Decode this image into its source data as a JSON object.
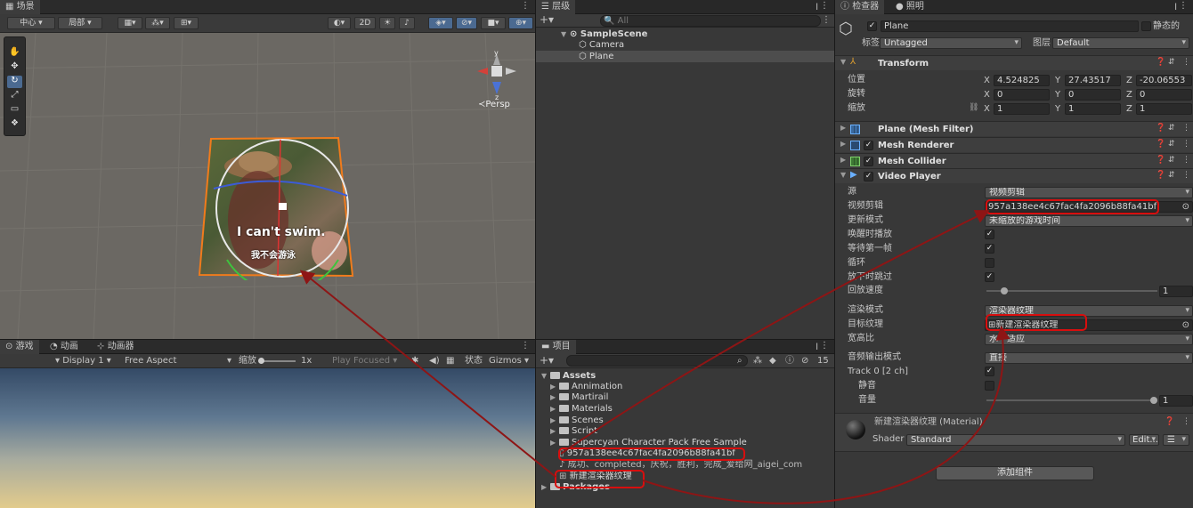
{
  "scene": {
    "tab": "场景",
    "pivot": "中心",
    "space": "局部",
    "mode_2d": "2D",
    "persp": "≺Persp",
    "axis_y": "y",
    "axis_z": "z",
    "subtitle_en": "I can't swim.",
    "subtitle_cn": "我不会游泳"
  },
  "game": {
    "tabs": [
      "游戏",
      "动画",
      "动画器"
    ],
    "display": "Display 1",
    "aspect": "Free Aspect",
    "scale_label": "缩放",
    "scale_value": "1x",
    "play_focused": "Play Focused",
    "stats": "状态",
    "gizmos": "Gizmos"
  },
  "hierarchy": {
    "tab": "层级",
    "search_placeholder": "All",
    "scene": "SampleScene",
    "items": [
      "Camera",
      "Plane"
    ]
  },
  "project": {
    "tab": "项目",
    "count": "15",
    "root": "Assets",
    "folders": [
      "Annimation",
      "Martirail",
      "Materials",
      "Scenes",
      "Script",
      "Supercyan Character Pack Free Sample"
    ],
    "files": [
      "957a138ee4c67fac4fa2096b88fa41bf",
      "成功、completed，庆祝，胜利，完成_爱给网_aigei_com",
      "新建渲染器纹理"
    ],
    "packages": "Packages"
  },
  "inspector": {
    "tabs": [
      "检查器",
      "照明"
    ],
    "object_name": "Plane",
    "static_label": "静态的",
    "tag_label": "标签",
    "tag_value": "Untagged",
    "layer_label": "图层",
    "layer_value": "Default",
    "transform": {
      "title": "Transform",
      "rows": [
        {
          "label": "位置",
          "x": "4.524825",
          "y": "27.43517",
          "z": "-20.06553"
        },
        {
          "label": "旋转",
          "x": "0",
          "y": "0",
          "z": "0"
        },
        {
          "label": "缩放",
          "x": "1",
          "y": "1",
          "z": "1"
        }
      ]
    },
    "components": [
      "Plane (Mesh Filter)",
      "Mesh Renderer",
      "Mesh Collider",
      "Video Player"
    ],
    "video": {
      "source_label": "源",
      "source_value": "视频剪辑",
      "clip_label": "视频剪辑",
      "clip_value": "957a138ee4c67fac4fa2096b88fa41bf",
      "update_label": "更新模式",
      "update_value": "未缩放的游戏时间",
      "playonawake_label": "唤醒时播放",
      "waitfirst_label": "等待第一帧",
      "loop_label": "循环",
      "skip_label": "放下时跳过",
      "speed_label": "回放速度",
      "speed_value": "1",
      "render_mode_label": "渲染模式",
      "render_mode_value": "渲染器纹理",
      "target_label": "目标纹理",
      "target_value": "新建渲染器纹理",
      "aspect_label": "宽高比",
      "aspect_value": "水平适应",
      "audio_label": "音频输出模式",
      "audio_value": "直接",
      "track_label": "Track 0 [2 ch]",
      "mute_label": "静音",
      "volume_label": "音量",
      "volume_value": "1"
    },
    "material_name": "新建渲染器纹理 (Material)",
    "shader_label": "Shader",
    "shader_value": "Standard",
    "edit_label": "Edit...",
    "add_component": "添加组件"
  },
  "colors": {
    "annotation": "#d80e0e",
    "selection": "#4b6a91"
  }
}
